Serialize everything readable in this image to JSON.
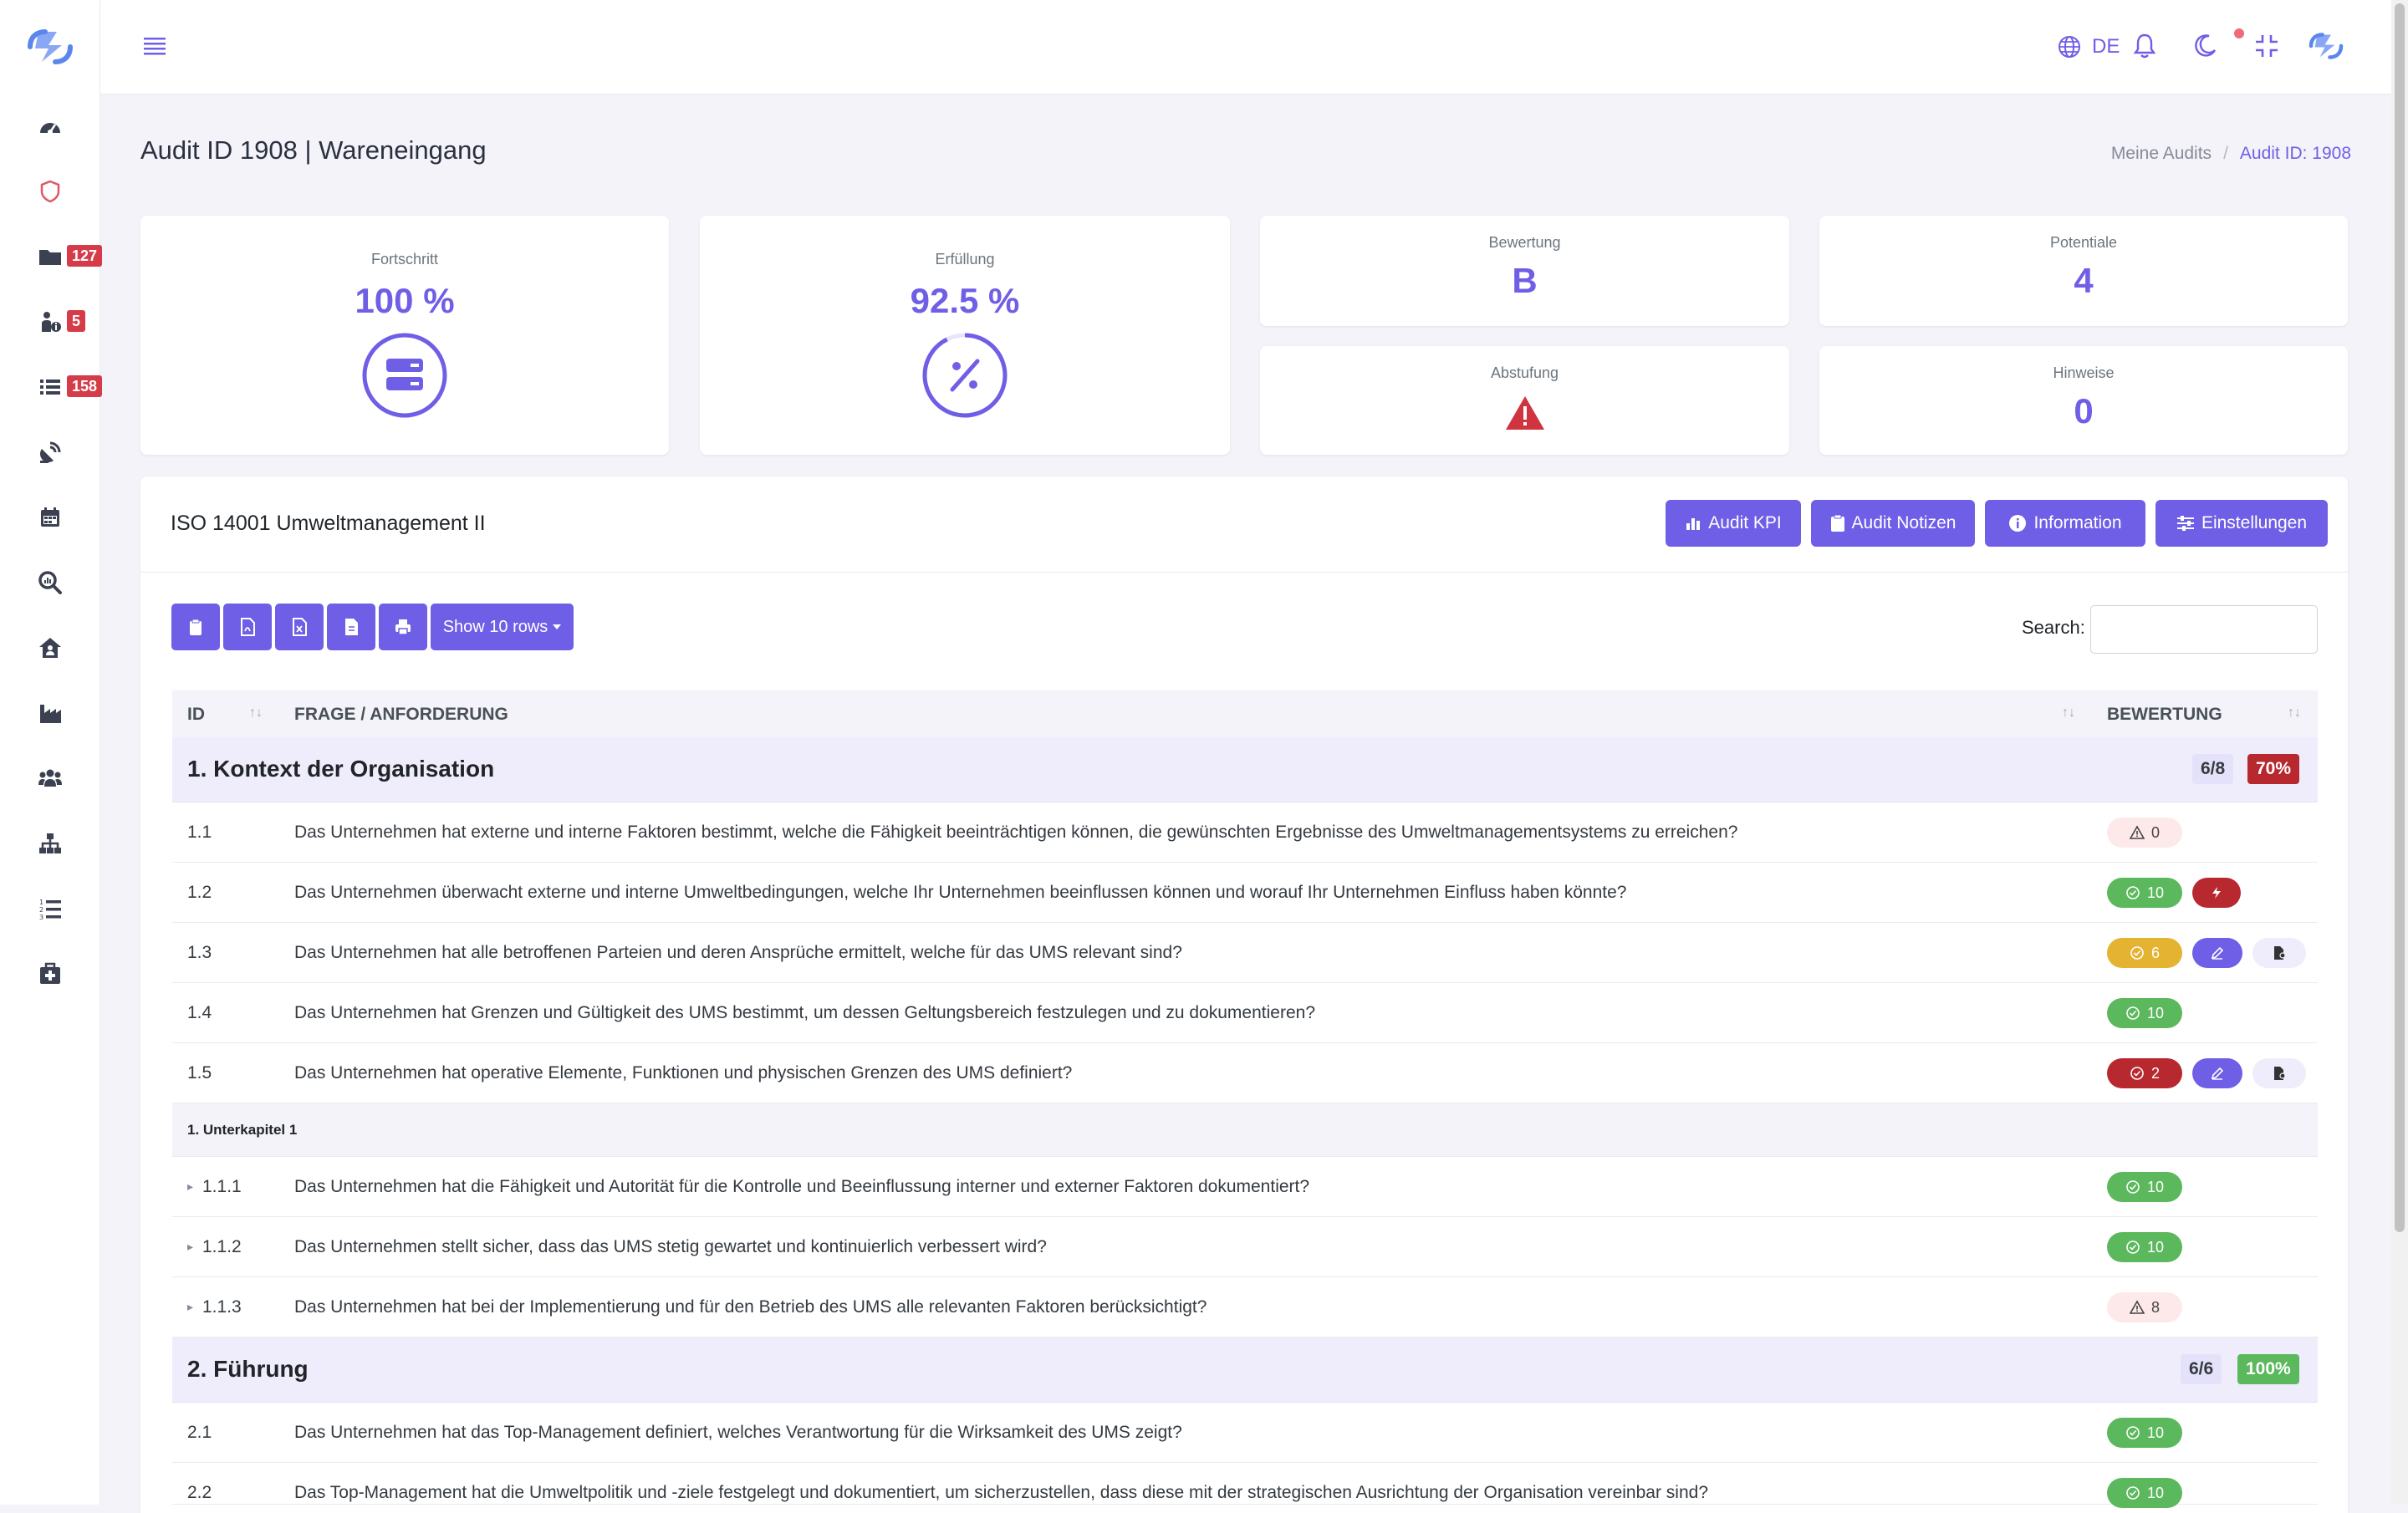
{
  "header": {
    "language": "DE"
  },
  "sidebar": {
    "items": [
      {
        "icon": "dashboard-icon"
      },
      {
        "icon": "shield-icon"
      },
      {
        "icon": "folder-icon",
        "badge": "127"
      },
      {
        "icon": "person-info-icon",
        "badge": "5"
      },
      {
        "icon": "list-icon",
        "badge": "158"
      },
      {
        "icon": "satellite-dish-icon"
      },
      {
        "icon": "calendar-icon"
      },
      {
        "icon": "search-chart-icon"
      },
      {
        "icon": "house-user-icon"
      },
      {
        "icon": "industry-icon"
      },
      {
        "icon": "users-icon"
      },
      {
        "icon": "sitemap-icon"
      },
      {
        "icon": "list-ol-icon"
      },
      {
        "icon": "first-aid-kit-icon"
      }
    ]
  },
  "page": {
    "title": "Audit ID 1908 | Wareneingang",
    "breadcrumb": {
      "parent": "Meine Audits",
      "separator": "/",
      "current": "Audit ID: 1908"
    }
  },
  "stats": {
    "fortschritt": {
      "label": "Fortschritt",
      "value": "100 %",
      "level": 1.0
    },
    "erfuellung": {
      "label": "Erfüllung",
      "value": "92.5 %",
      "level": 0.925
    },
    "bewertung": {
      "label": "Bewertung",
      "value": "B"
    },
    "potentiale": {
      "label": "Potentiale",
      "value": "4"
    },
    "abstufung": {
      "label": "Abstufung",
      "icon": "warning-triangle-icon"
    },
    "hinweise": {
      "label": "Hinweise",
      "value": "0"
    }
  },
  "audit": {
    "name": "ISO 14001 Umweltmanagement II",
    "buttons": {
      "kpi": "Audit KPI",
      "notes": "Audit Notizen",
      "info": "Information",
      "settings": "Einstellungen"
    }
  },
  "toolbar": {
    "show_rows": "Show 10 rows",
    "search_label": "Search:",
    "search_value": ""
  },
  "table": {
    "columns": {
      "id": "ID",
      "question": "FRAGE / ANFORDERUNG",
      "rating": "BEWERTUNG"
    },
    "section1": {
      "title": "1. Kontext der Organisation",
      "fraction": "6/8",
      "percent": "70%"
    },
    "rows1": [
      {
        "id": "1.1",
        "text": "Das Unternehmen hat externe und interne Faktoren bestimmt, welche die Fähigkeit beeinträchtigen können, die gewünschten Ergebnisse des Umweltmanagementsystems zu erreichen?",
        "score": "0"
      },
      {
        "id": "1.2",
        "text": "Das Unternehmen überwacht externe und interne Umweltbedingungen, welche Ihr Unternehmen beeinflussen können und worauf Ihr Unternehmen Einfluss haben könnte?",
        "score": "10"
      },
      {
        "id": "1.3",
        "text": "Das Unternehmen hat alle betroffenen Parteien und deren Ansprüche ermittelt, welche für das UMS relevant sind?",
        "score": "6"
      },
      {
        "id": "1.4",
        "text": "Das Unternehmen hat Grenzen und Gültigkeit des UMS bestimmt, um dessen Geltungsbereich festzulegen und zu dokumentieren?",
        "score": "10"
      },
      {
        "id": "1.5",
        "text": "Das Unternehmen hat operative Elemente, Funktionen und physischen Grenzen des UMS definiert?",
        "score": "2"
      }
    ],
    "subchapter": "1. Unterkapitel 1",
    "rows_sub": [
      {
        "id": "1.1.1",
        "text": "Das Unternehmen hat die Fähigkeit und Autorität für die Kontrolle und Beeinflussung interner und externer Faktoren dokumentiert?",
        "score": "10"
      },
      {
        "id": "1.1.2",
        "text": "Das Unternehmen stellt sicher, dass das UMS stetig gewartet und kontinuierlich verbessert wird?",
        "score": "10"
      },
      {
        "id": "1.1.3",
        "text": "Das Unternehmen hat bei der Implementierung und für den Betrieb des UMS alle relevanten Faktoren berücksichtigt?",
        "score": "8"
      }
    ],
    "section2": {
      "title": "2. Führung",
      "fraction": "6/6",
      "percent": "100%"
    },
    "rows2": [
      {
        "id": "2.1",
        "text": "Das Unternehmen hat das Top-Management definiert, welches Verantwortung für die Wirksamkeit des UMS zeigt?",
        "score": "10"
      },
      {
        "id": "2.2",
        "text": "Das Top-Management hat die Umweltpolitik und -ziele festgelegt und dokumentiert, um sicherzustellen, dass diese mit der strategischen Ausrichtung der Organisation vereinbar sind?",
        "score": "10"
      }
    ]
  },
  "colors": {
    "accent": "#6f5ee6",
    "success": "#5bb85d",
    "warning": "#e4b332",
    "danger": "#b8282f"
  }
}
